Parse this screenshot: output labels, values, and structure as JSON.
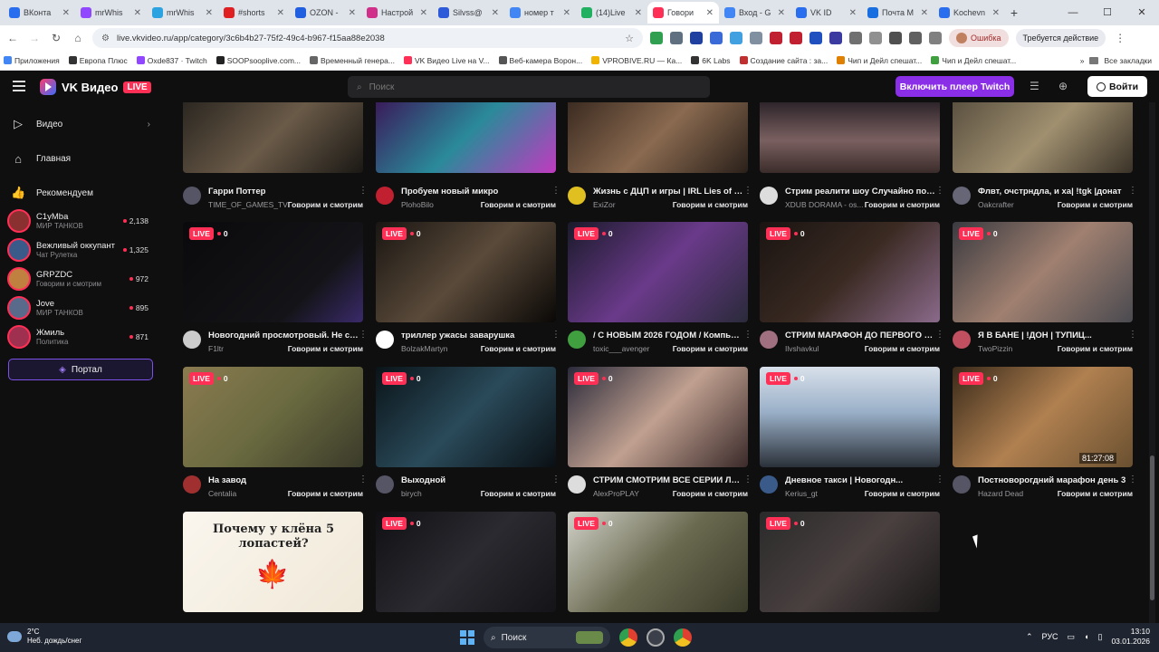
{
  "browser": {
    "tabs": [
      {
        "label": "ВКонта",
        "color": "#2a6ef0",
        "active": false
      },
      {
        "label": "mrWhis",
        "color": "#9146ff",
        "active": false
      },
      {
        "label": "mrWhis",
        "color": "#2aa3e0",
        "active": false
      },
      {
        "label": "#shorts",
        "color": "#e02020",
        "active": false
      },
      {
        "label": "OZON -",
        "color": "#2060e0",
        "active": false
      },
      {
        "label": "Настрой",
        "color": "#d0308a",
        "active": false
      },
      {
        "label": "Silvss@",
        "color": "#2c5ad8",
        "active": false
      },
      {
        "label": "номер т",
        "color": "#4285f4",
        "active": false
      },
      {
        "label": "(14)Live",
        "color": "#20b060",
        "active": false
      },
      {
        "label": "Говори",
        "color": "#ff2f55",
        "active": true
      },
      {
        "label": "Вход - G",
        "color": "#4285f4",
        "active": false
      },
      {
        "label": "VK ID",
        "color": "#2a6ef0",
        "active": false
      },
      {
        "label": "Почта М",
        "color": "#1a6fe0",
        "active": false
      },
      {
        "label": "Kochevn",
        "color": "#2a6ef0",
        "active": false
      }
    ],
    "url": "live.vkvideo.ru/app/category/3c6b4b27-75f2-49c4-b967-f15aa88e2038",
    "error_label": "Ошибка",
    "action_label": "Требуется действие",
    "bookmarks": [
      {
        "label": "Приложения",
        "color": "#4285f4"
      },
      {
        "label": "Европа Плюс",
        "color": "#333"
      },
      {
        "label": "Oxde837 · Twitch",
        "color": "#9146ff"
      },
      {
        "label": "SOOPsooplive.com...",
        "color": "#222"
      },
      {
        "label": "Временный генера...",
        "color": "#666"
      },
      {
        "label": "VK Видео Live на V...",
        "color": "#ff2f55"
      },
      {
        "label": "Веб-камера Ворон...",
        "color": "#555"
      },
      {
        "label": "VPROBIVE.RU — Ка...",
        "color": "#f0b400"
      },
      {
        "label": "6K Labs",
        "color": "#333"
      },
      {
        "label": "Создание сайта : за...",
        "color": "#c03030"
      },
      {
        "label": "Чип и Дейл спешат...",
        "color": "#e08000"
      },
      {
        "label": "Чип и Дейл спешат...",
        "color": "#40a040"
      }
    ],
    "all_bookmarks": "Все закладки"
  },
  "header": {
    "logo_text": "VK Видео",
    "live_badge": "LIVE",
    "search_placeholder": "Поиск",
    "twitch_button": "Включить плеер Twitch",
    "login_button": "Войти"
  },
  "sidebar": {
    "nav": [
      {
        "label": "Видео",
        "icon": "play-square-icon",
        "glyph": "▷",
        "chevron": true
      },
      {
        "label": "Главная",
        "icon": "home-icon",
        "glyph": "⌂",
        "chevron": false
      },
      {
        "label": "Рекомендуем",
        "icon": "thumbs-up-icon",
        "glyph": "👍",
        "chevron": false
      }
    ],
    "channels": [
      {
        "name": "C1yMba",
        "category": "МИР ТАНКОВ",
        "viewers": "2,138",
        "color": "#8a3030"
      },
      {
        "name": "Вежливый оккупант",
        "category": "Чат Рулетка",
        "viewers": "1,325",
        "color": "#3a5a8a"
      },
      {
        "name": "GRPZDC",
        "category": "Говорим и смотрим",
        "viewers": "972",
        "color": "#c08040"
      },
      {
        "name": "Jove",
        "category": "МИР ТАНКОВ",
        "viewers": "895",
        "color": "#5a6a8a"
      },
      {
        "name": "Жмиль",
        "category": "Политика",
        "viewers": "871",
        "color": "#a03050"
      }
    ],
    "portal_button": "Портал"
  },
  "cards": [
    {
      "title": "Гарри Поттер",
      "streamer": "TIME_OF_GAMES_TV",
      "category": "Говорим и смотрим",
      "viewers": "",
      "bg": "linear-gradient(135deg,#2a2620,#6a5a48 50%,#1a1814)",
      "av": "#556"
    },
    {
      "title": "Пробуем новый микро",
      "streamer": "PlohoBilo",
      "category": "Говорим и смотрим",
      "viewers": "",
      "bg": "linear-gradient(135deg,#3a1a5a,#2a8a9a 50%,#c03ac0)",
      "av": "#c02030"
    },
    {
      "title": "Жизнь с ДЦП и игры | IRL Lies of P ...",
      "streamer": "ExiZor",
      "category": "Говорим и смотрим",
      "viewers": "",
      "bg": "linear-gradient(135deg,#3a2a20,#8a6a50 50%,#2a201a)",
      "av": "#e0c020"
    },
    {
      "title": "Стрим реалити шоу Случайно поех...",
      "streamer": "XDUB DORAMA - os...",
      "category": "Говорим и смотрим",
      "viewers": "",
      "bg": "linear-gradient(180deg,#2a2228,#7a6060 55%,#3a2c2a)",
      "av": "#ddd"
    },
    {
      "title": "Флвт, очстрндла, и ха| !tgk |донат",
      "streamer": "Oakcrafter",
      "category": "Говорим и смотрим",
      "viewers": "",
      "bg": "linear-gradient(135deg,#5a5040,#a09070 50%,#3a3228)",
      "av": "#667"
    },
    {
      "title": "Новогодний просмотровый. Не сов...",
      "streamer": "F1ltr",
      "category": "Говорим и смотрим",
      "viewers": "0",
      "bg": "linear-gradient(135deg,#0a0a0c,#141418 70%,#3a2a6a)",
      "av": "#ccc"
    },
    {
      "title": "триллер ужасы заварушка",
      "streamer": "BolzakMartyn",
      "category": "Говорим и смотрим",
      "viewers": "0",
      "bg": "linear-gradient(135deg,#1a1612,#5a4a3a 50%,#0a0806)",
      "av": "#fff"
    },
    {
      "title": "/ С НОВЫМ 2026 ГОДОМ / Компью...",
      "streamer": "toxic___avenger",
      "category": "Говорим и смотрим",
      "viewers": "0",
      "bg": "linear-gradient(135deg,#1a1a2a,#6a3a8a 50%,#2a2a3a)",
      "av": "#40a040"
    },
    {
      "title": "СТРИМ МАРАФОН ДО ПЕРВОГО М...",
      "streamer": "Ilvshavkul",
      "category": "Говорим и смотрим",
      "viewers": "0",
      "bg": "linear-gradient(135deg,#1a1412,#3a2a22 50%,#8a6a8a)",
      "av": "#a07080"
    },
    {
      "title": "Я В БАНЕ | !ДОН | ТУПИЦ...",
      "streamer": "TwoPizzin",
      "category": "Говорим и смотрим",
      "viewers": "0",
      "bg": "linear-gradient(135deg,#3a3a40,#a08070 50%,#4a4a50)",
      "av": "#c05060"
    },
    {
      "title": "На завод",
      "streamer": "Centalia",
      "category": "Говорим и смотрим",
      "viewers": "0",
      "bg": "linear-gradient(135deg,#8a7a50,#6a6a40 50%,#3a3a2a)",
      "av": "#a03030"
    },
    {
      "title": "Выходной",
      "streamer": "birych",
      "category": "Говорим и смотрим",
      "viewers": "0",
      "bg": "linear-gradient(135deg,#0a1418,#2a4a5a 50%,#0a1014)",
      "av": "#556"
    },
    {
      "title": "СТРИМ СМОТРИМ ВСЕ СЕРИИ ЛЕД...",
      "streamer": "AlexProPLAY",
      "category": "Говорим и смотрим",
      "viewers": "0",
      "bg": "linear-gradient(135deg,#2a2a3a,#c0a090 50%,#3a2a2a)",
      "av": "#ddd"
    },
    {
      "title": "Дневное такси | Новогодн...",
      "streamer": "Kerius_gt",
      "category": "Говорим и смотрим",
      "viewers": "0",
      "bg": "linear-gradient(180deg,#d8e0ea,#9ab0c8 45%,#2a3038)",
      "av": "#3a5a8a"
    },
    {
      "title": "Постноворогдний марафон день 3",
      "streamer": "Hazard Dead",
      "category": "Говорим и смотрим",
      "viewers": "0",
      "bg": "linear-gradient(135deg,#3a2a1a,#b08050 50%,#6a5030)",
      "av": "#556",
      "timer": "81:27:08"
    },
    {
      "title": "",
      "streamer": "",
      "category": "",
      "viewers": "",
      "bg": "linear-gradient(135deg,#faf6ee,#f0e8d8)",
      "av": "#556",
      "board": "Почему у клёна 5 лопастей?"
    },
    {
      "title": "",
      "streamer": "",
      "category": "",
      "viewers": "0",
      "bg": "linear-gradient(135deg,#101014,#2a2a30 50%,#141418)",
      "av": "#556"
    },
    {
      "title": "",
      "streamer": "",
      "category": "",
      "viewers": "0",
      "bg": "linear-gradient(135deg,#d0d0c8,#6a6a50 50%,#3a3a2a)",
      "av": "#556"
    },
    {
      "title": "",
      "streamer": "",
      "category": "",
      "viewers": "0",
      "bg": "linear-gradient(135deg,#2a2a2a,#4a4040 50%,#1a1818)",
      "av": "#556"
    }
  ],
  "taskbar": {
    "temperature": "2°C",
    "weather_text": "Неб. дождь/снег",
    "search_label": "Поиск",
    "lang": "РУС",
    "time": "13:10",
    "date": "03.01.2026"
  }
}
